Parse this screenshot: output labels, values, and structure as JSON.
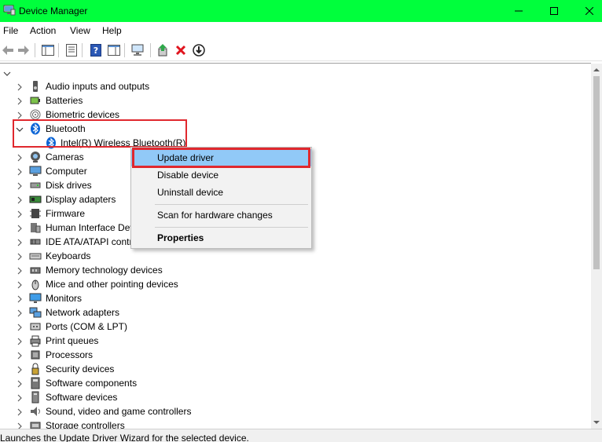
{
  "window": {
    "title": "Device Manager",
    "titlebar_color": "#00ff3c"
  },
  "menu": [
    "File",
    "Action",
    "View",
    "Help"
  ],
  "toolbar": {
    "buttons": [
      "back-arrow-icon",
      "forward-arrow-icon",
      "show-hide-console-tree-icon",
      "properties-icon",
      "help-icon",
      "console-pane-icon",
      "scan-hardware-icon",
      "update-driver-icon",
      "uninstall-device-icon",
      "disable-device-icon"
    ]
  },
  "tree": {
    "categories": [
      {
        "label": "Audio inputs and outputs",
        "icon": "speaker-icon"
      },
      {
        "label": "Batteries",
        "icon": "battery-icon"
      },
      {
        "label": "Biometric devices",
        "icon": "fingerprint-icon"
      },
      {
        "label": "Bluetooth",
        "icon": "bluetooth-icon",
        "expanded": true
      },
      {
        "label": "Cameras",
        "icon": "camera-icon"
      },
      {
        "label": "Computer",
        "icon": "computer-icon"
      },
      {
        "label": "Disk drives",
        "icon": "disk-drive-icon"
      },
      {
        "label": "Display adapters",
        "icon": "display-adapter-icon"
      },
      {
        "label": "Firmware",
        "icon": "firmware-icon"
      },
      {
        "label": "Human Interface Dev",
        "icon": "hid-icon"
      },
      {
        "label": "IDE ATA/ATAPI contr",
        "icon": "ide-controller-icon"
      },
      {
        "label": "Keyboards",
        "icon": "keyboard-icon"
      },
      {
        "label": "Memory technology devices",
        "icon": "memory-icon"
      },
      {
        "label": "Mice and other pointing devices",
        "icon": "mouse-icon"
      },
      {
        "label": "Monitors",
        "icon": "monitor-icon"
      },
      {
        "label": "Network adapters",
        "icon": "network-adapter-icon"
      },
      {
        "label": "Ports (COM & LPT)",
        "icon": "port-icon"
      },
      {
        "label": "Print queues",
        "icon": "printer-icon"
      },
      {
        "label": "Processors",
        "icon": "processor-icon"
      },
      {
        "label": "Security devices",
        "icon": "security-device-icon"
      },
      {
        "label": "Software components",
        "icon": "software-component-icon"
      },
      {
        "label": "Software devices",
        "icon": "software-device-icon"
      },
      {
        "label": "Sound, video and game controllers",
        "icon": "sound-controller-icon"
      },
      {
        "label": "Storage controllers",
        "icon": "storage-controller-icon"
      }
    ],
    "bluetooth_child": {
      "label": "Intel(R) Wireless Bluetooth(R)",
      "icon": "bluetooth-icon"
    }
  },
  "context_menu": {
    "items": [
      {
        "label": "Update driver",
        "selected": true
      },
      {
        "label": "Disable device"
      },
      {
        "label": "Uninstall device"
      },
      {
        "label": "Scan for hardware changes"
      },
      {
        "label": "Properties",
        "bold": true
      }
    ]
  },
  "status": {
    "text": "Launches the Update Driver Wizard for the selected device."
  },
  "colors": {
    "highlight_red": "#e0282e",
    "menu_selected": "#91c9f7",
    "bluetooth_blue": "#0a64d6"
  }
}
